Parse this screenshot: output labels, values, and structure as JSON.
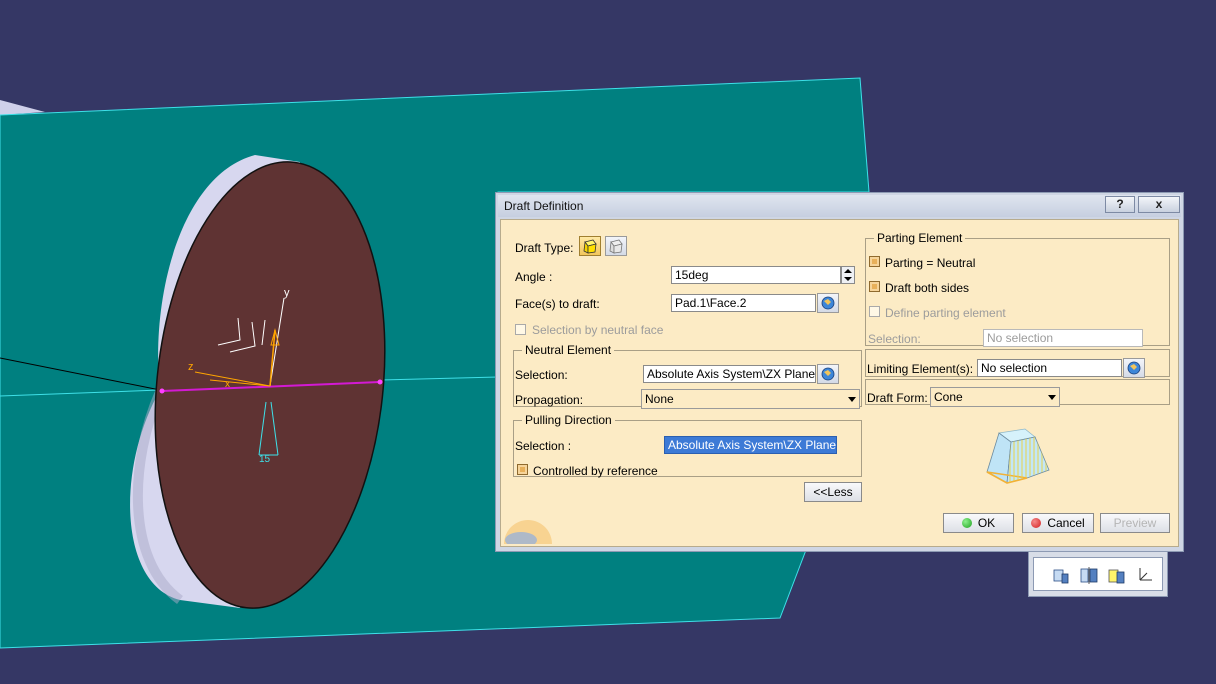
{
  "dialog": {
    "title": "Draft Definition",
    "help_label": "?",
    "close_label": "x",
    "draft_type_label": "Draft Type:",
    "angle_label": "Angle :",
    "angle_value": "15deg",
    "faces_label": "Face(s) to draft:",
    "faces_value": "Pad.1\\Face.2",
    "selection_by_neutral_face": "Selection by neutral face",
    "neutral_element": {
      "title": "Neutral Element",
      "selection_label": "Selection:",
      "selection_value": "Absolute Axis System\\ZX Plane",
      "propagation_label": "Propagation:",
      "propagation_value": "None"
    },
    "pulling_direction": {
      "title": "Pulling Direction",
      "selection_label": "Selection :",
      "selection_value": "Absolute Axis System\\ZX Plane",
      "controlled_by_reference": "Controlled by reference"
    },
    "less_button": "<<Less",
    "parting_element": {
      "title": "Parting Element",
      "parting_neutral": "Parting = Neutral",
      "draft_both_sides": "Draft both sides",
      "define_parting_element": "Define parting element",
      "selection_label": "Selection:",
      "selection_value": "No selection"
    },
    "limiting_elements_label": "Limiting Element(s):",
    "limiting_elements_value": "No selection",
    "draft_form_label": "Draft Form:",
    "draft_form_value": "Cone",
    "ok_label": "OK",
    "cancel_label": "Cancel",
    "preview_label": "Preview"
  },
  "viewport": {
    "axis_y": "y",
    "axis_z": "z",
    "axis_x": "x",
    "angle_annotation": "15"
  },
  "colors": {
    "background": "#353765",
    "plane": "#008080",
    "plane_edge": "#3ee0e8",
    "disc_face": "#5f3333",
    "disc_side": "#d7d7ef",
    "neutral_line": "#d31ad3",
    "dialog_body": "#fcebc5",
    "ok_dot": "#1ea21e",
    "cancel_dot": "#d41e1e"
  },
  "toolbar": {
    "icons": [
      "draft-icon",
      "draft-reflect-icon",
      "variable-draft-icon",
      "axis-system-icon"
    ]
  }
}
